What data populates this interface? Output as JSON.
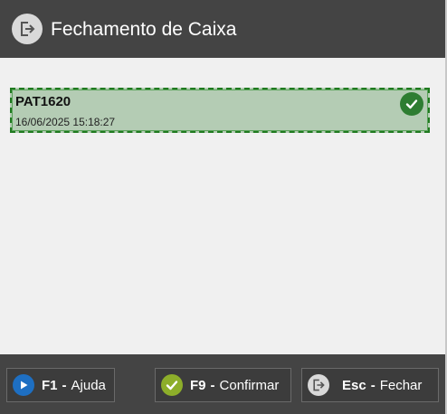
{
  "dialog": {
    "title": "Fechamento de Caixa",
    "title_icon": "logout-icon"
  },
  "list": {
    "items": [
      {
        "title": "PAT1620",
        "datetime": "16/06/2025 15:18:27",
        "status_icon": "check-circle-icon",
        "selected": true
      }
    ]
  },
  "footer": {
    "help": {
      "key": "F1",
      "sep": "-",
      "label": "Ajuda",
      "icon": "play-icon"
    },
    "confirm": {
      "key": "F9",
      "sep": "-",
      "label": "Confirmar",
      "icon": "check-circle-icon"
    },
    "close": {
      "key": "Esc",
      "sep": "-",
      "label": "Fechar",
      "icon": "logout-icon"
    }
  },
  "colors": {
    "header_bg": "#444444",
    "content_bg": "#f0f0f0",
    "selected_item_bg": "#b4ccb4",
    "selected_item_border": "#1f7a1f",
    "check_green": "#2e7d32",
    "help_blue": "#1e6fc2",
    "confirm_green": "#8dae2a"
  }
}
